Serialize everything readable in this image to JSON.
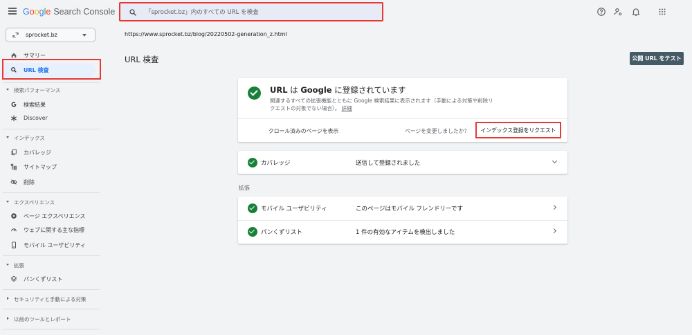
{
  "header": {
    "logo": {
      "G": "G",
      "o1": "o",
      "o2": "o",
      "g": "g",
      "l": "l",
      "e": "e",
      "product": "Search Console"
    },
    "search_placeholder": "「sprocket.bz」内のすべての URL を検査",
    "icons": [
      "help-icon",
      "manage-accounts-icon",
      "notifications-icon",
      "apps-grid-icon"
    ]
  },
  "property": {
    "label": "sprocket.bz"
  },
  "inspected_url": "https://www.sprocket.bz/blog/20220502-generation_z.html",
  "sidebar": {
    "summary": "サマリー",
    "url_inspection": "URL 検査",
    "sections": {
      "performance": {
        "title": "検索パフォーマンス",
        "items": [
          "検索結果",
          "Discover"
        ]
      },
      "index": {
        "title": "インデックス",
        "items": [
          "カバレッジ",
          "サイトマップ",
          "削除"
        ]
      },
      "experience": {
        "title": "エクスペリエンス",
        "items": [
          "ページ エクスペリエンス",
          "ウェブに関する主な指標",
          "モバイル ユーザビリティ"
        ]
      },
      "enhancements": {
        "title": "拡張",
        "items": [
          "パンくずリスト"
        ]
      },
      "security": {
        "title": "セキュリティと手動による対策"
      },
      "legacy": {
        "title": "以前のツールとレポート"
      }
    }
  },
  "main": {
    "title": "URL 検査",
    "test_live_button": "公開 URL をテスト",
    "status": {
      "title_prefix": "URL",
      "title_mid": " は ",
      "title_brand": "Google",
      "title_suffix": " に登録されています",
      "description": "関連するすべての拡張機能とともに Google 検索結果に表示されます（手動による対策や削除リクエストの対象でない場合）。",
      "details_link": "詳細",
      "crawled_link": "クロール済みのページを表示",
      "changed_question": "ページを変更しましたか？",
      "request_button": "インデックス登録をリクエスト"
    },
    "coverage": {
      "label": "カバレッジ",
      "value": "送信して登録されました"
    },
    "enhancements_label": "拡張",
    "enhancements": [
      {
        "label": "モバイル ユーザビリティ",
        "value": "このページはモバイル フレンドリーです"
      },
      {
        "label": "パンくずリスト",
        "value": "1 件の有効なアイテムを検出しました"
      }
    ]
  },
  "colors": {
    "accent": "#1a73e8",
    "success": "#188038",
    "highlight": "#e53935",
    "button_dark": "#455a64"
  }
}
